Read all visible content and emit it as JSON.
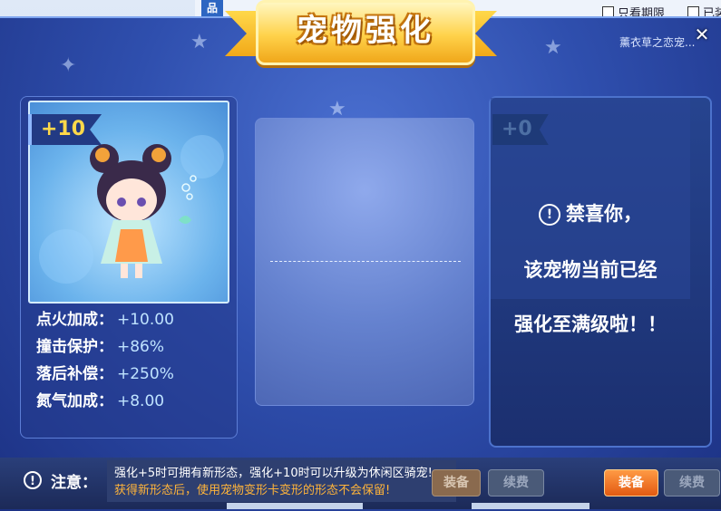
{
  "background": {
    "badge": "品",
    "filters": [
      {
        "label": "只看期限"
      },
      {
        "label": "已装"
      }
    ],
    "side_text": "薰衣草之恋宠..."
  },
  "dialog": {
    "title": "宠物强化",
    "close_icon": "close-icon",
    "left_pet": {
      "level": "+10",
      "stats": [
        {
          "label": "点火加成：",
          "value": "+10.00"
        },
        {
          "label": "撞击保护：",
          "value": "+86%"
        },
        {
          "label": "落后补偿：",
          "value": "+250%"
        },
        {
          "label": "氮气加成：",
          "value": "+8.00"
        }
      ]
    },
    "right_pet": {
      "level": "+0",
      "message_line1": "禁喜你，",
      "message_line2": "该宠物当前已经",
      "message_line3": "强化至满级啦！！",
      "message_icon": "exclamation-icon"
    },
    "notice": {
      "label": "注意：",
      "line1": "强化+5时可拥有新形态，强化+10时可以升级为休闲区骑宠!",
      "line2": "获得新形态后，使用宠物变形卡变形的形态不会保留!"
    },
    "buttons": {
      "equip": "装备",
      "renew": "续费"
    }
  },
  "colors": {
    "accent_gold": "#ffd84a",
    "notice_orange": "#ffb43a",
    "equip_orange": "#e25a12"
  }
}
